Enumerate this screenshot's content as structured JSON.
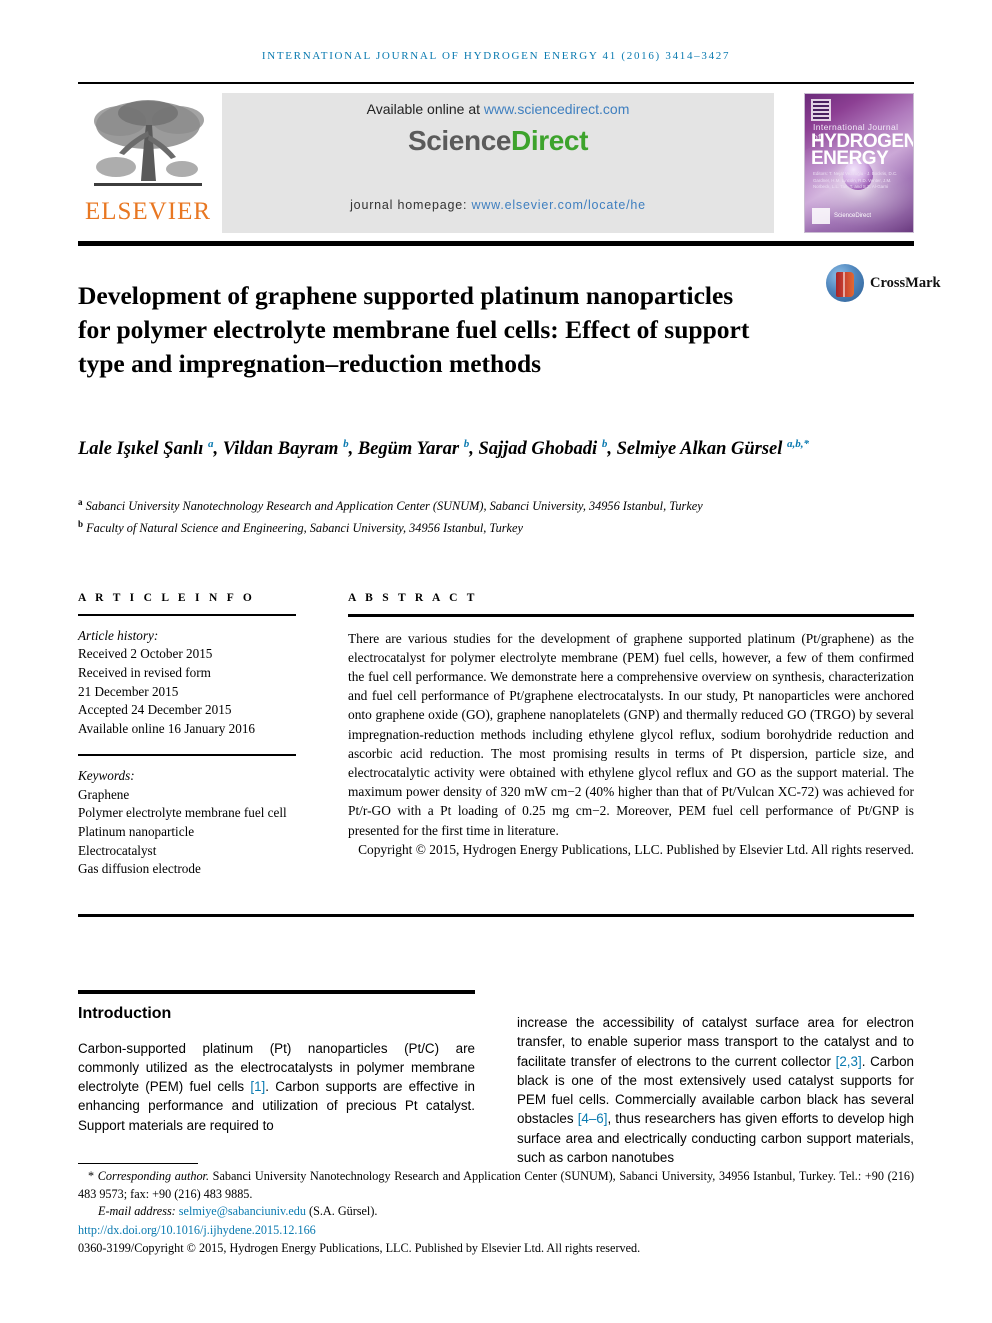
{
  "running_head": "International Journal of Hydrogen Energy 41 (2016) 3414–3427",
  "masthead": {
    "publisher_name": "ELSEVIER",
    "available_label": "Available online at ",
    "available_url": "www.sciencedirect.com",
    "logo_science": "Science",
    "logo_direct": "Direct",
    "homepage_label": "journal homepage: ",
    "homepage_url": "www.elsevier.com/locate/he",
    "cover": {
      "line_small": "International Journal of",
      "line1": "HYDROGEN",
      "line2": "ENERGY",
      "editors": "Editors: T. Nejat Veziroğlu  ·  J. Bockris, D.C. Gardner, H.M. Lincoln,  R.D. Venter, J.M. Norbeck, L.L. Tan, T. and S.Z. Al-Garni",
      "science_direct": "ScienceDirect"
    }
  },
  "crossmark": {
    "label": "CrossMark"
  },
  "title": "Development of graphene supported platinum nanoparticles for polymer electrolyte membrane fuel cells: Effect of support type and impregnation–reduction methods",
  "authors": [
    {
      "name": "Lale Işıkel Şanlı",
      "marks": "a"
    },
    {
      "name": "Vildan Bayram",
      "marks": "b"
    },
    {
      "name": "Begüm Yarar",
      "marks": "b"
    },
    {
      "name": "Sajjad Ghobadi",
      "marks": "b"
    },
    {
      "name": "Selmiye Alkan Gürsel",
      "marks": "a,b,*"
    }
  ],
  "affiliations": [
    {
      "mark": "a",
      "text": "Sabanci University Nanotechnology Research and Application Center (SUNUM), Sabanci University, 34956 Istanbul, Turkey"
    },
    {
      "mark": "b",
      "text": "Faculty of Natural Science and Engineering, Sabanci University, 34956 Istanbul, Turkey"
    }
  ],
  "article_info": {
    "heading": "A R T I C L E   I N F O",
    "history_label": "Article history:",
    "history": [
      "Received 2 October 2015",
      "Received in revised form",
      "21 December 2015",
      "Accepted 24 December 2015",
      "Available online 16 January 2016"
    ],
    "keywords_label": "Keywords:",
    "keywords": [
      "Graphene",
      "Polymer electrolyte membrane fuel cell",
      "Platinum nanoparticle",
      "Electrocatalyst",
      "Gas diffusion electrode"
    ]
  },
  "abstract": {
    "heading": "A B S T R A C T",
    "body": "There are various studies for the development of graphene supported platinum (Pt/graphene) as the electrocatalyst for polymer electrolyte membrane (PEM) fuel cells, however, a few of them confirmed the fuel cell performance. We demonstrate here a comprehensive overview on synthesis, characterization and fuel cell performance of Pt/graphene electrocatalysts. In our study, Pt nanoparticles were anchored onto graphene oxide (GO), graphene nanoplatelets (GNP) and thermally reduced GO (TRGO) by several impregnation-reduction methods including ethylene glycol reflux, sodium borohydride reduction and ascorbic acid reduction. The most promising results in terms of Pt dispersion, particle size, and electrocatalytic activity were obtained with ethylene glycol reflux and GO as the support material. The maximum power density of 320 mW cm−2 (40% higher than that of Pt/Vulcan XC-72) was achieved for Pt/r-GO with a Pt loading of 0.25 mg cm−2. Moreover, PEM fuel cell performance of Pt/GNP is presented for the first time in literature.",
    "copyright": "Copyright © 2015, Hydrogen Energy Publications, LLC. Published by Elsevier Ltd. All rights reserved."
  },
  "introduction": {
    "heading": "Introduction",
    "left_paragraph_pre": "Carbon-supported platinum (Pt) nanoparticles (Pt/C) are commonly utilized as the electrocatalysts in polymer membrane electrolyte (PEM) fuel cells ",
    "left_ref_1": "[1]",
    "left_paragraph_post": ". Carbon supports are effective in enhancing performance and utilization of precious Pt catalyst. Support materials are required to",
    "right_pre": "increase the accessibility of catalyst surface area for electron transfer, to enable superior mass transport to the catalyst and to facilitate transfer of electrons to the current collector ",
    "right_ref_1": "[2,3]",
    "right_mid": ". Carbon black is one of the most extensively used catalyst supports for PEM fuel cells. Commercially available carbon black has several obstacles ",
    "right_ref_2": "[4–6]",
    "right_post": ", thus researchers has given efforts to develop high surface area and electrically conducting carbon support materials, such as carbon nanotubes"
  },
  "footnotes": {
    "corresponding_mark": "*",
    "corresponding_label": "Corresponding author.",
    "corresponding_text": " Sabanci University Nanotechnology Research and Application Center (SUNUM), Sabanci University, 34956 Istanbul, Turkey. Tel.: +90 (216) 483 9573; fax: +90 (216) 483 9885.",
    "email_label": "E-mail address: ",
    "email": "selmiye@sabanciuniv.edu",
    "email_suffix": " (S.A. Gürsel).",
    "doi": "http://dx.doi.org/10.1016/j.ijhydene.2015.12.166",
    "issn_copyright": "0360-3199/Copyright © 2015, Hydrogen Energy Publications, LLC. Published by Elsevier Ltd. All rights reserved."
  },
  "colors": {
    "link": "#0a7ab0",
    "elsevier_orange": "#E87722",
    "sciencedirect_green": "#3DA32C"
  }
}
